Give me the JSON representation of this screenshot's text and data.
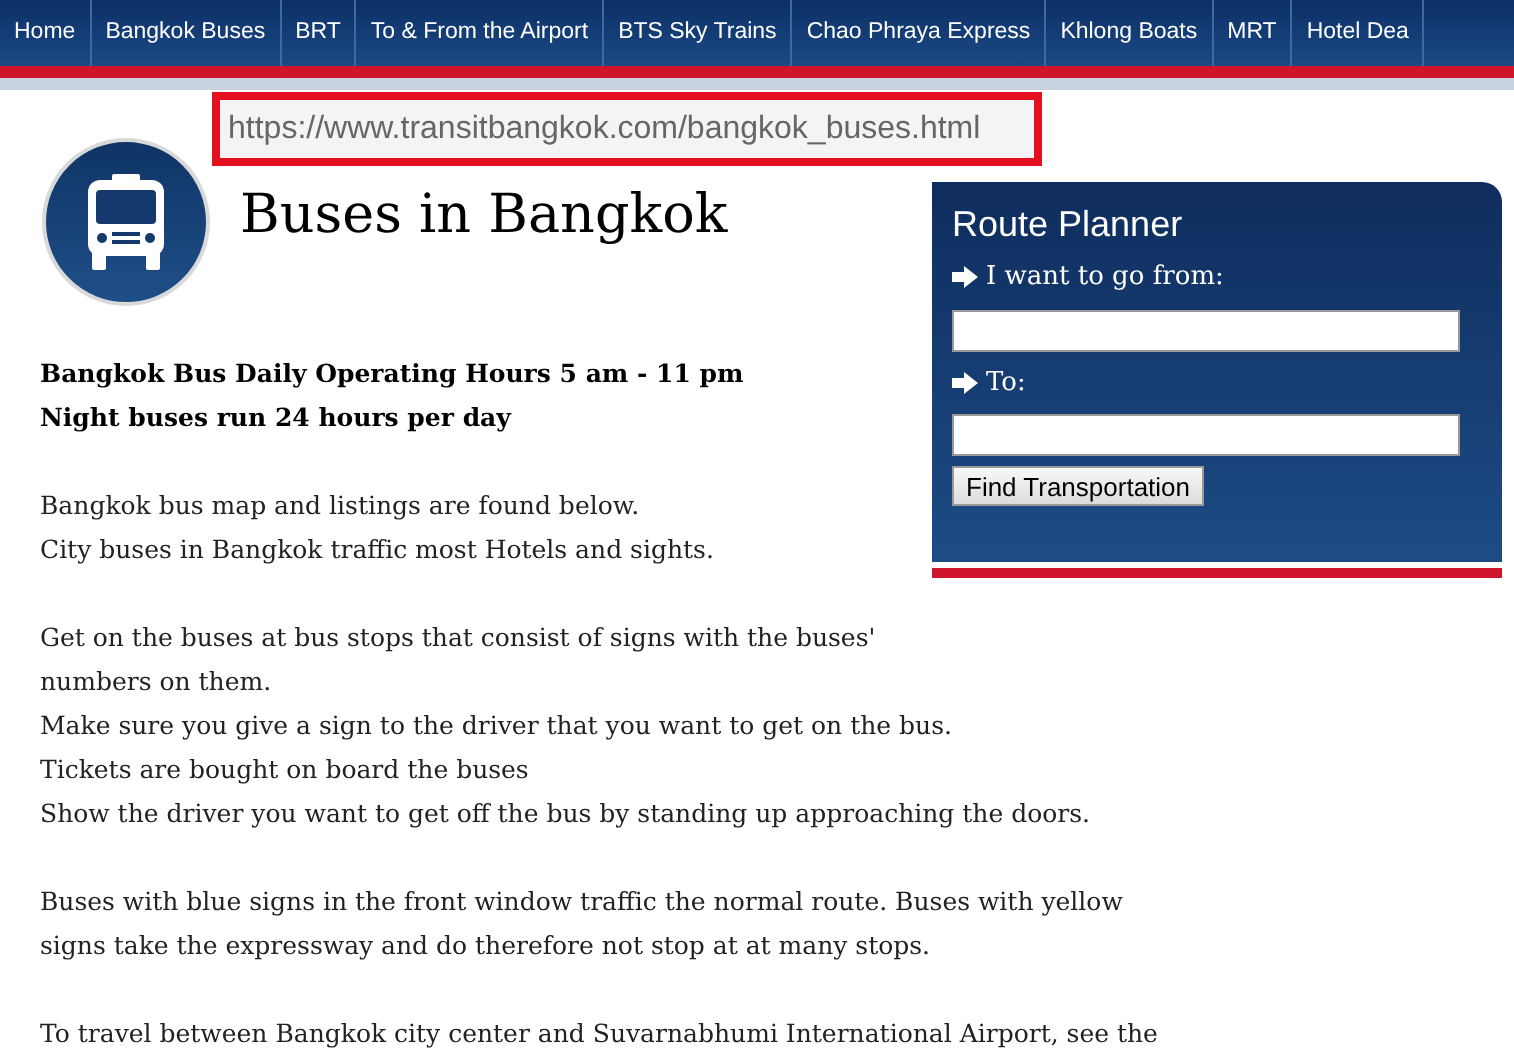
{
  "nav": [
    "Home",
    "Bangkok Buses",
    "BRT",
    "To & From the Airport",
    "BTS Sky Trains",
    "Chao Phraya Express",
    "Khlong Boats",
    "MRT",
    "Hotel Dea"
  ],
  "url_callout": "https://www.transitbangkok.com/bangkok_buses.html",
  "title": "Buses in Bangkok",
  "paragraphs": [
    {
      "bold": true,
      "lines": [
        "Bangkok Bus Daily Operating Hours 5 am - 11 pm",
        "Night buses run 24 hours per day"
      ]
    },
    {
      "bold": false,
      "lines": [
        "Bangkok bus map and listings are found below.",
        "City buses in Bangkok traffic most Hotels and sights."
      ]
    },
    {
      "bold": false,
      "lines": [
        "Get on the buses at bus stops that consist of signs with the buses'",
        "numbers on them.",
        "Make sure you give a sign to the driver that you want to get on the bus.",
        "Tickets are bought on board the buses",
        "Show the driver you want to get off the bus by standing up approaching the doors."
      ]
    },
    {
      "bold": false,
      "lines": [
        "Buses with blue signs in the front window traffic the normal route. Buses with yellow",
        "signs take the expressway and do therefore not stop at at many stops."
      ]
    },
    {
      "bold": false,
      "lines": [
        "To travel between Bangkok city center and Suvarnabhumi International Airport, see the"
      ]
    }
  ],
  "route_planner": {
    "title": "Route Planner",
    "fields": [
      {
        "label": "I want to go from:"
      },
      {
        "label": "To:"
      }
    ],
    "button": "Find Transportation"
  }
}
